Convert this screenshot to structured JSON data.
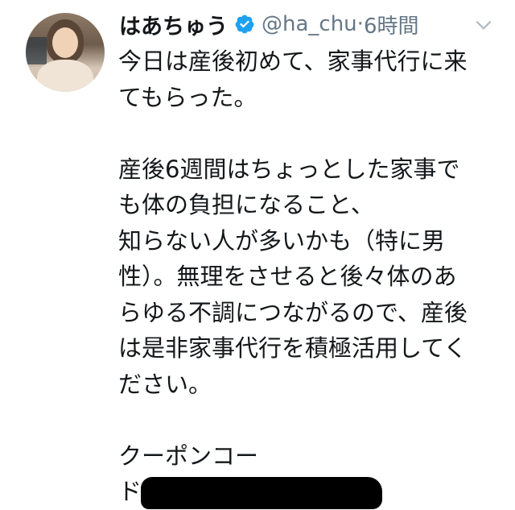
{
  "tweet": {
    "author_name": "はあちゅう",
    "handle": "@ha_chu",
    "separator": "·",
    "time": "6時間",
    "lines": [
      "今日は産後初めて、家事代行に来",
      "てもらった。",
      "",
      "産後6週間はちょっとした家事で",
      "も体の負担になること、",
      "知らない人が多いかも（特に男",
      "性）。無理をさせると後々体のあ",
      "らゆる不調につながるので、産後",
      "は是非家事代行を積極活用してく",
      "ださい。",
      "",
      "クーポンコー",
      "ド:"
    ]
  },
  "icons": {
    "verified": "verified-badge-icon",
    "more": "chevron-down-icon",
    "verified_color": "#1da1f2"
  }
}
